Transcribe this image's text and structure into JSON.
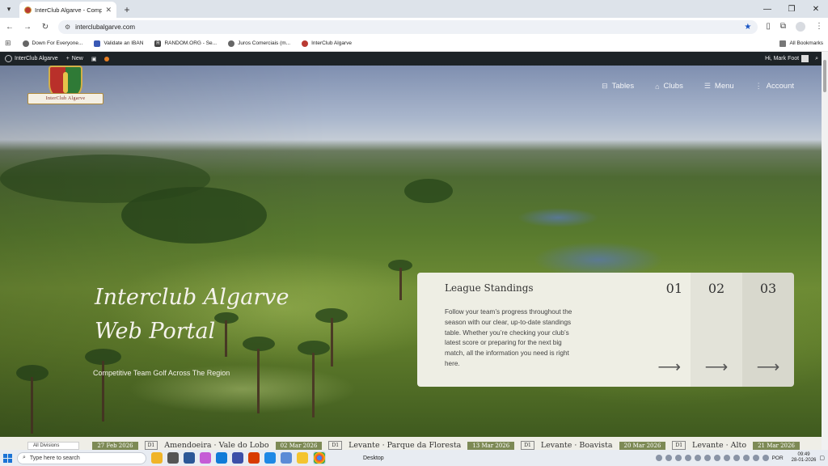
{
  "browser": {
    "tab": {
      "title": "InterClub Algarve - Competitiv",
      "close": "✕"
    },
    "new_tab": "+",
    "window_controls": [
      "—",
      "❐",
      "✕"
    ],
    "url": "interclubalgarve.com",
    "bookmarks": [
      {
        "label": "Down For Everyone...",
        "icon": "globe-icon"
      },
      {
        "label": "Validate an IBAN",
        "icon": "iban-icon"
      },
      {
        "label": "RANDOM.ORG - Se...",
        "icon": "random-org-icon"
      },
      {
        "label": "Juros Comerciais (m...",
        "icon": "globe-icon"
      },
      {
        "label": "InterClub Algarve",
        "icon": "club-icon"
      }
    ],
    "all_bookmarks": "All Bookmarks"
  },
  "wp_admin_bar": {
    "site_name": "InterClub Algarve",
    "new_label": "New",
    "greeting": "Hi, Mark Foot"
  },
  "site": {
    "logo_text": "InterClub Algarve",
    "nav": [
      {
        "label": "Tables",
        "icon": "table-icon"
      },
      {
        "label": "Clubs",
        "icon": "clubs-icon"
      },
      {
        "label": "Menu",
        "icon": "menu-icon"
      },
      {
        "label": "Account",
        "icon": "account-icon"
      }
    ],
    "hero": {
      "title": "Interclub Algarve Web Portal",
      "subtitle": "Competitive Team Golf Across The Region"
    },
    "panels": {
      "main": {
        "number": "01",
        "title": "League Standings",
        "body": "Follow your team’s progress throughout the season with our clear, up-to-date standings table. Whether you’re checking your club’s latest score or preparing for the next big match, all the information you need is right here.",
        "arrow": "⟶"
      },
      "second": {
        "number": "02",
        "arrow": "⟶"
      },
      "third": {
        "number": "03",
        "arrow": "⟶"
      }
    },
    "ticker": {
      "division_select": "All Divisions",
      "fixtures": [
        {
          "date": "27 Feb 2026",
          "division": "D1",
          "match": "Amendoeira  ·  Vale do Lobo"
        },
        {
          "date": "02 Mar 2026",
          "division": "D1",
          "match": "Levante  ·  Parque da Floresta"
        },
        {
          "date": "13 Mar 2026",
          "division": "D1",
          "match": "Levante  ·  Boavista"
        },
        {
          "date": "20 Mar 2026",
          "division": "D1",
          "match": "Levante  ·  Alto"
        },
        {
          "date": "21 Mar 2026",
          "division": "",
          "match": ""
        }
      ]
    }
  },
  "taskbar": {
    "search_placeholder": "Type here to search",
    "desktop_label": "Desktop",
    "language": "POR",
    "time": "09:49",
    "date": "28-01-2026"
  }
}
